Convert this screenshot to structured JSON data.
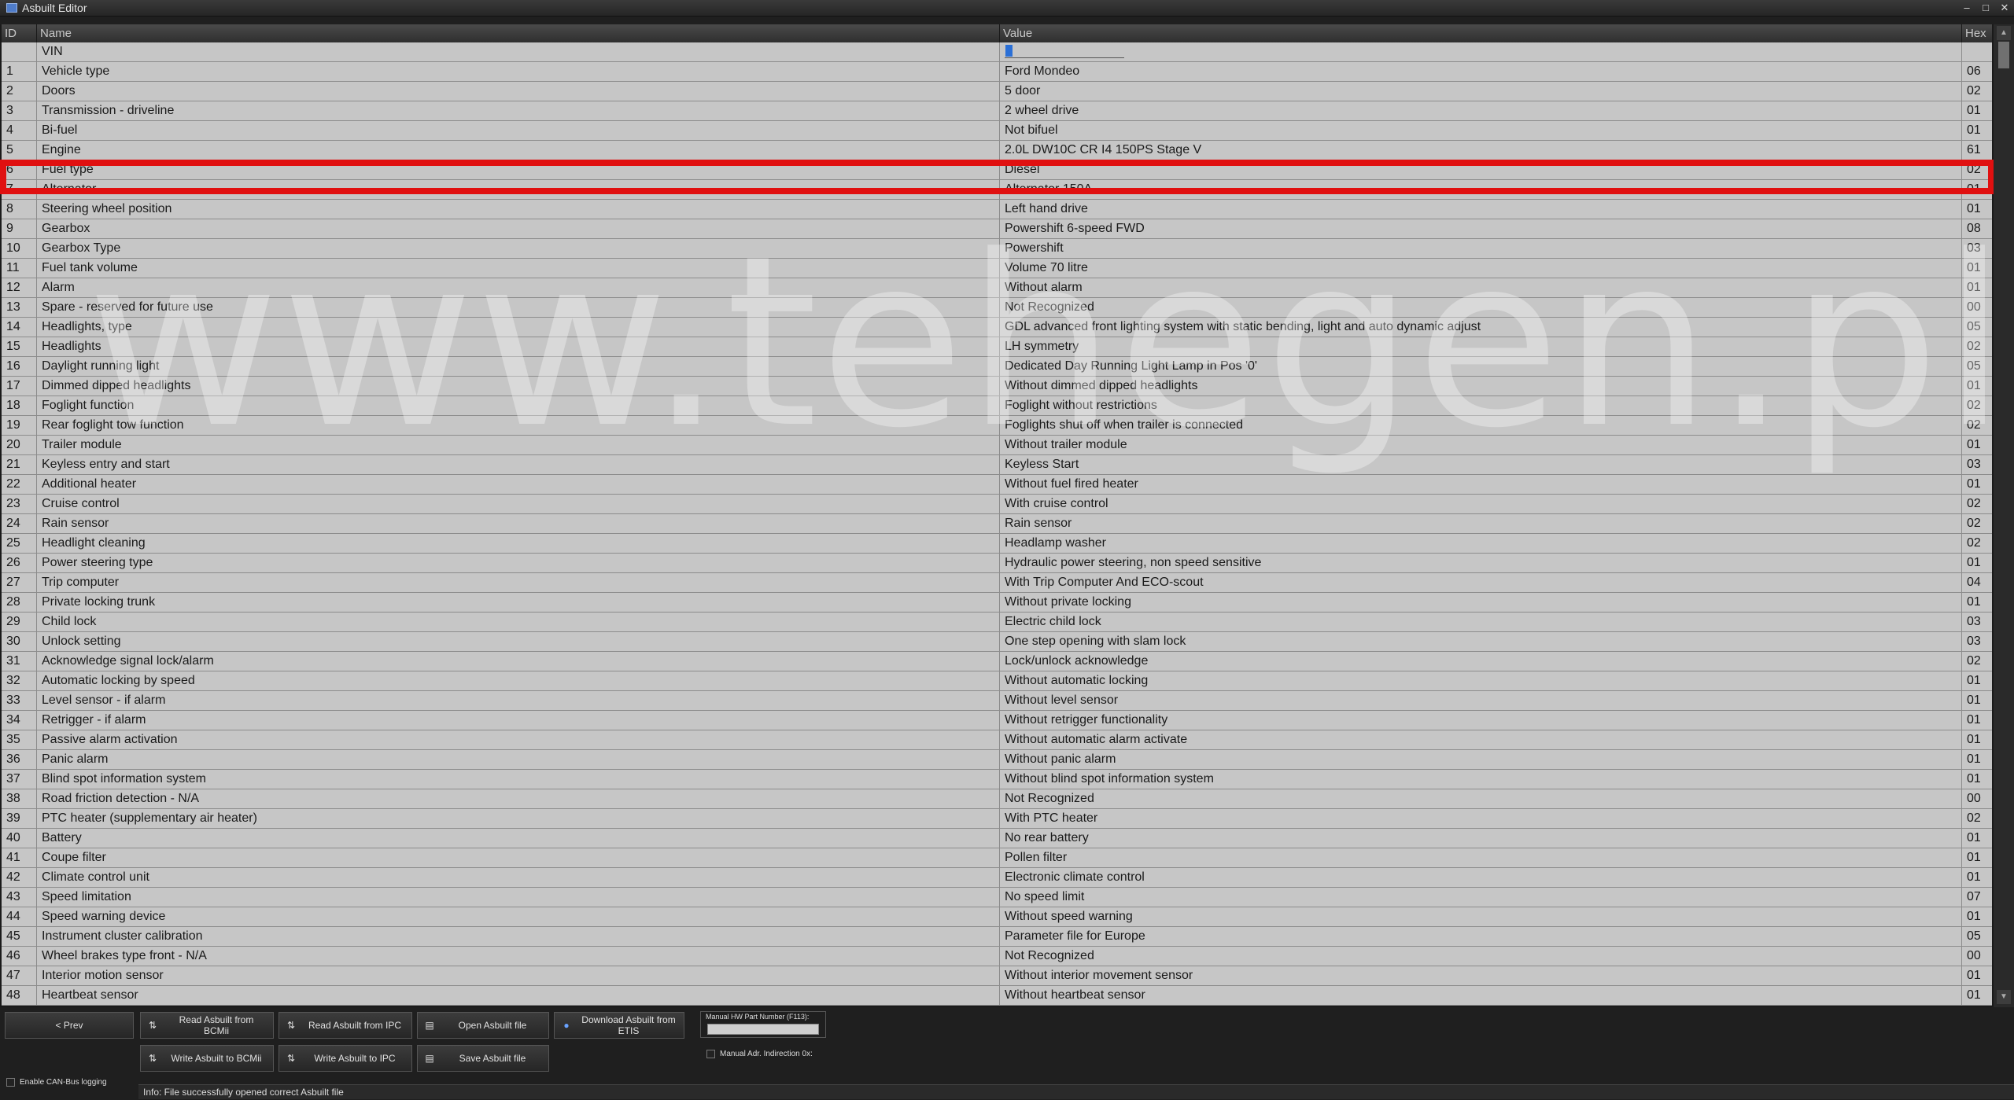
{
  "window": {
    "title": "Asbuilt Editor",
    "minimize": "–",
    "maximize": "□",
    "close": "✕"
  },
  "columns": {
    "id": "ID",
    "name": "Name",
    "value": "Value",
    "hex": "Hex"
  },
  "vin": {
    "label": "VIN"
  },
  "rows": [
    {
      "id": "1",
      "name": "Vehicle type",
      "value": "Ford Mondeo",
      "hex": "06"
    },
    {
      "id": "2",
      "name": "Doors",
      "value": "5 door",
      "hex": "02"
    },
    {
      "id": "3",
      "name": "Transmission - driveline",
      "value": "2 wheel drive",
      "hex": "01"
    },
    {
      "id": "4",
      "name": "Bi-fuel",
      "value": "Not bifuel",
      "hex": "01"
    },
    {
      "id": "5",
      "name": "Engine",
      "value": "2.0L DW10C CR I4 150PS Stage V",
      "hex": "61"
    },
    {
      "id": "6",
      "name": "Fuel type",
      "value": "Diesel",
      "hex": "02"
    },
    {
      "id": "7",
      "name": "Alternator",
      "value": "Alternator 150A",
      "hex": "01"
    },
    {
      "id": "8",
      "name": "Steering wheel position",
      "value": "Left hand drive",
      "hex": "01"
    },
    {
      "id": "9",
      "name": "Gearbox",
      "value": "Powershift 6-speed FWD",
      "hex": "08"
    },
    {
      "id": "10",
      "name": "Gearbox Type",
      "value": "Powershift",
      "hex": "03"
    },
    {
      "id": "11",
      "name": "Fuel tank volume",
      "value": "Volume 70 litre",
      "hex": "01"
    },
    {
      "id": "12",
      "name": "Alarm",
      "value": "Without alarm",
      "hex": "01"
    },
    {
      "id": "13",
      "name": "Spare - reserved for future use",
      "value": "Not Recognized",
      "hex": "00"
    },
    {
      "id": "14",
      "name": "Headlights, type",
      "value": "GDL advanced front lighting system with static bending, light and auto dynamic adjust",
      "hex": "05"
    },
    {
      "id": "15",
      "name": "Headlights",
      "value": "LH symmetry",
      "hex": "02"
    },
    {
      "id": "16",
      "name": "Daylight running light",
      "value": "Dedicated Day Running Light Lamp in Pos '0'",
      "hex": "05"
    },
    {
      "id": "17",
      "name": "Dimmed dipped headlights",
      "value": "Without dimmed dipped headlights",
      "hex": "01"
    },
    {
      "id": "18",
      "name": "Foglight function",
      "value": "Foglight without restrictions",
      "hex": "02"
    },
    {
      "id": "19",
      "name": "Rear foglight tow function",
      "value": "Foglights shut off when trailer is connected",
      "hex": "02"
    },
    {
      "id": "20",
      "name": "Trailer module",
      "value": "Without trailer module",
      "hex": "01"
    },
    {
      "id": "21",
      "name": "Keyless entry and start",
      "value": "Keyless Start",
      "hex": "03"
    },
    {
      "id": "22",
      "name": "Additional heater",
      "value": "Without fuel fired heater",
      "hex": "01"
    },
    {
      "id": "23",
      "name": "Cruise control",
      "value": "With cruise control",
      "hex": "02"
    },
    {
      "id": "24",
      "name": "Rain sensor",
      "value": "Rain sensor",
      "hex": "02"
    },
    {
      "id": "25",
      "name": "Headlight cleaning",
      "value": "Headlamp washer",
      "hex": "02"
    },
    {
      "id": "26",
      "name": "Power steering type",
      "value": "Hydraulic power steering, non speed sensitive",
      "hex": "01"
    },
    {
      "id": "27",
      "name": "Trip computer",
      "value": "With Trip Computer And ECO-scout",
      "hex": "04"
    },
    {
      "id": "28",
      "name": "Private locking trunk",
      "value": "Without private locking",
      "hex": "01"
    },
    {
      "id": "29",
      "name": "Child lock",
      "value": "Electric child lock",
      "hex": "03"
    },
    {
      "id": "30",
      "name": "Unlock setting",
      "value": "One step opening with slam lock",
      "hex": "03"
    },
    {
      "id": "31",
      "name": "Acknowledge signal lock/alarm",
      "value": "Lock/unlock acknowledge",
      "hex": "02"
    },
    {
      "id": "32",
      "name": "Automatic locking by speed",
      "value": "Without automatic locking",
      "hex": "01"
    },
    {
      "id": "33",
      "name": "Level sensor - if alarm",
      "value": "Without level sensor",
      "hex": "01"
    },
    {
      "id": "34",
      "name": "Retrigger - if alarm",
      "value": "Without retrigger functionality",
      "hex": "01"
    },
    {
      "id": "35",
      "name": "Passive alarm activation",
      "value": "Without automatic alarm activate",
      "hex": "01"
    },
    {
      "id": "36",
      "name": "Panic alarm",
      "value": "Without panic alarm",
      "hex": "01"
    },
    {
      "id": "37",
      "name": "Blind spot information system",
      "value": "Without blind spot information system",
      "hex": "01"
    },
    {
      "id": "38",
      "name": "Road friction detection - N/A",
      "value": "Not Recognized",
      "hex": "00"
    },
    {
      "id": "39",
      "name": "PTC heater (supplementary air heater)",
      "value": "With PTC heater",
      "hex": "02"
    },
    {
      "id": "40",
      "name": "Battery",
      "value": "No rear battery",
      "hex": "01"
    },
    {
      "id": "41",
      "name": "Coupe filter",
      "value": "Pollen filter",
      "hex": "01"
    },
    {
      "id": "42",
      "name": "Climate control unit",
      "value": "Electronic climate control",
      "hex": "01"
    },
    {
      "id": "43",
      "name": "Speed limitation",
      "value": "No speed limit",
      "hex": "07"
    },
    {
      "id": "44",
      "name": "Speed warning device",
      "value": "Without speed warning",
      "hex": "01"
    },
    {
      "id": "45",
      "name": "Instrument cluster calibration",
      "value": "Parameter file for Europe",
      "hex": "05"
    },
    {
      "id": "46",
      "name": "Wheel brakes type front - N/A",
      "value": "Not Recognized",
      "hex": "00"
    },
    {
      "id": "47",
      "name": "Interior motion sensor",
      "value": "Without interior movement sensor",
      "hex": "01"
    },
    {
      "id": "48",
      "name": "Heartbeat sensor",
      "value": "Without heartbeat sensor",
      "hex": "01"
    }
  ],
  "watermark": "www.tehegen.pl",
  "buttons": {
    "prev": "< Prev",
    "read_bcm": "Read Asbuilt from BCMii",
    "read_ipc": "Read Asbuilt from IPC",
    "open_file": "Open Asbuilt file",
    "download_etis": "Download Asbuilt from ETIS",
    "write_bcm": "Write Asbuilt to BCMii",
    "write_ipc": "Write Asbuilt  to IPC",
    "save_file": "Save Asbuilt file"
  },
  "hw_part": {
    "label": "Manual HW Part Number (F113):",
    "value": ""
  },
  "manual_adr": "Manual Adr. Indirection 0x:",
  "can_logging": "Enable CAN-Bus logging",
  "status": "Info: File successfully opened correct Asbuilt file",
  "colors": {
    "highlight": "#e01010",
    "row_bg": "#c6c6c6",
    "accent": "#2a6fd6"
  }
}
